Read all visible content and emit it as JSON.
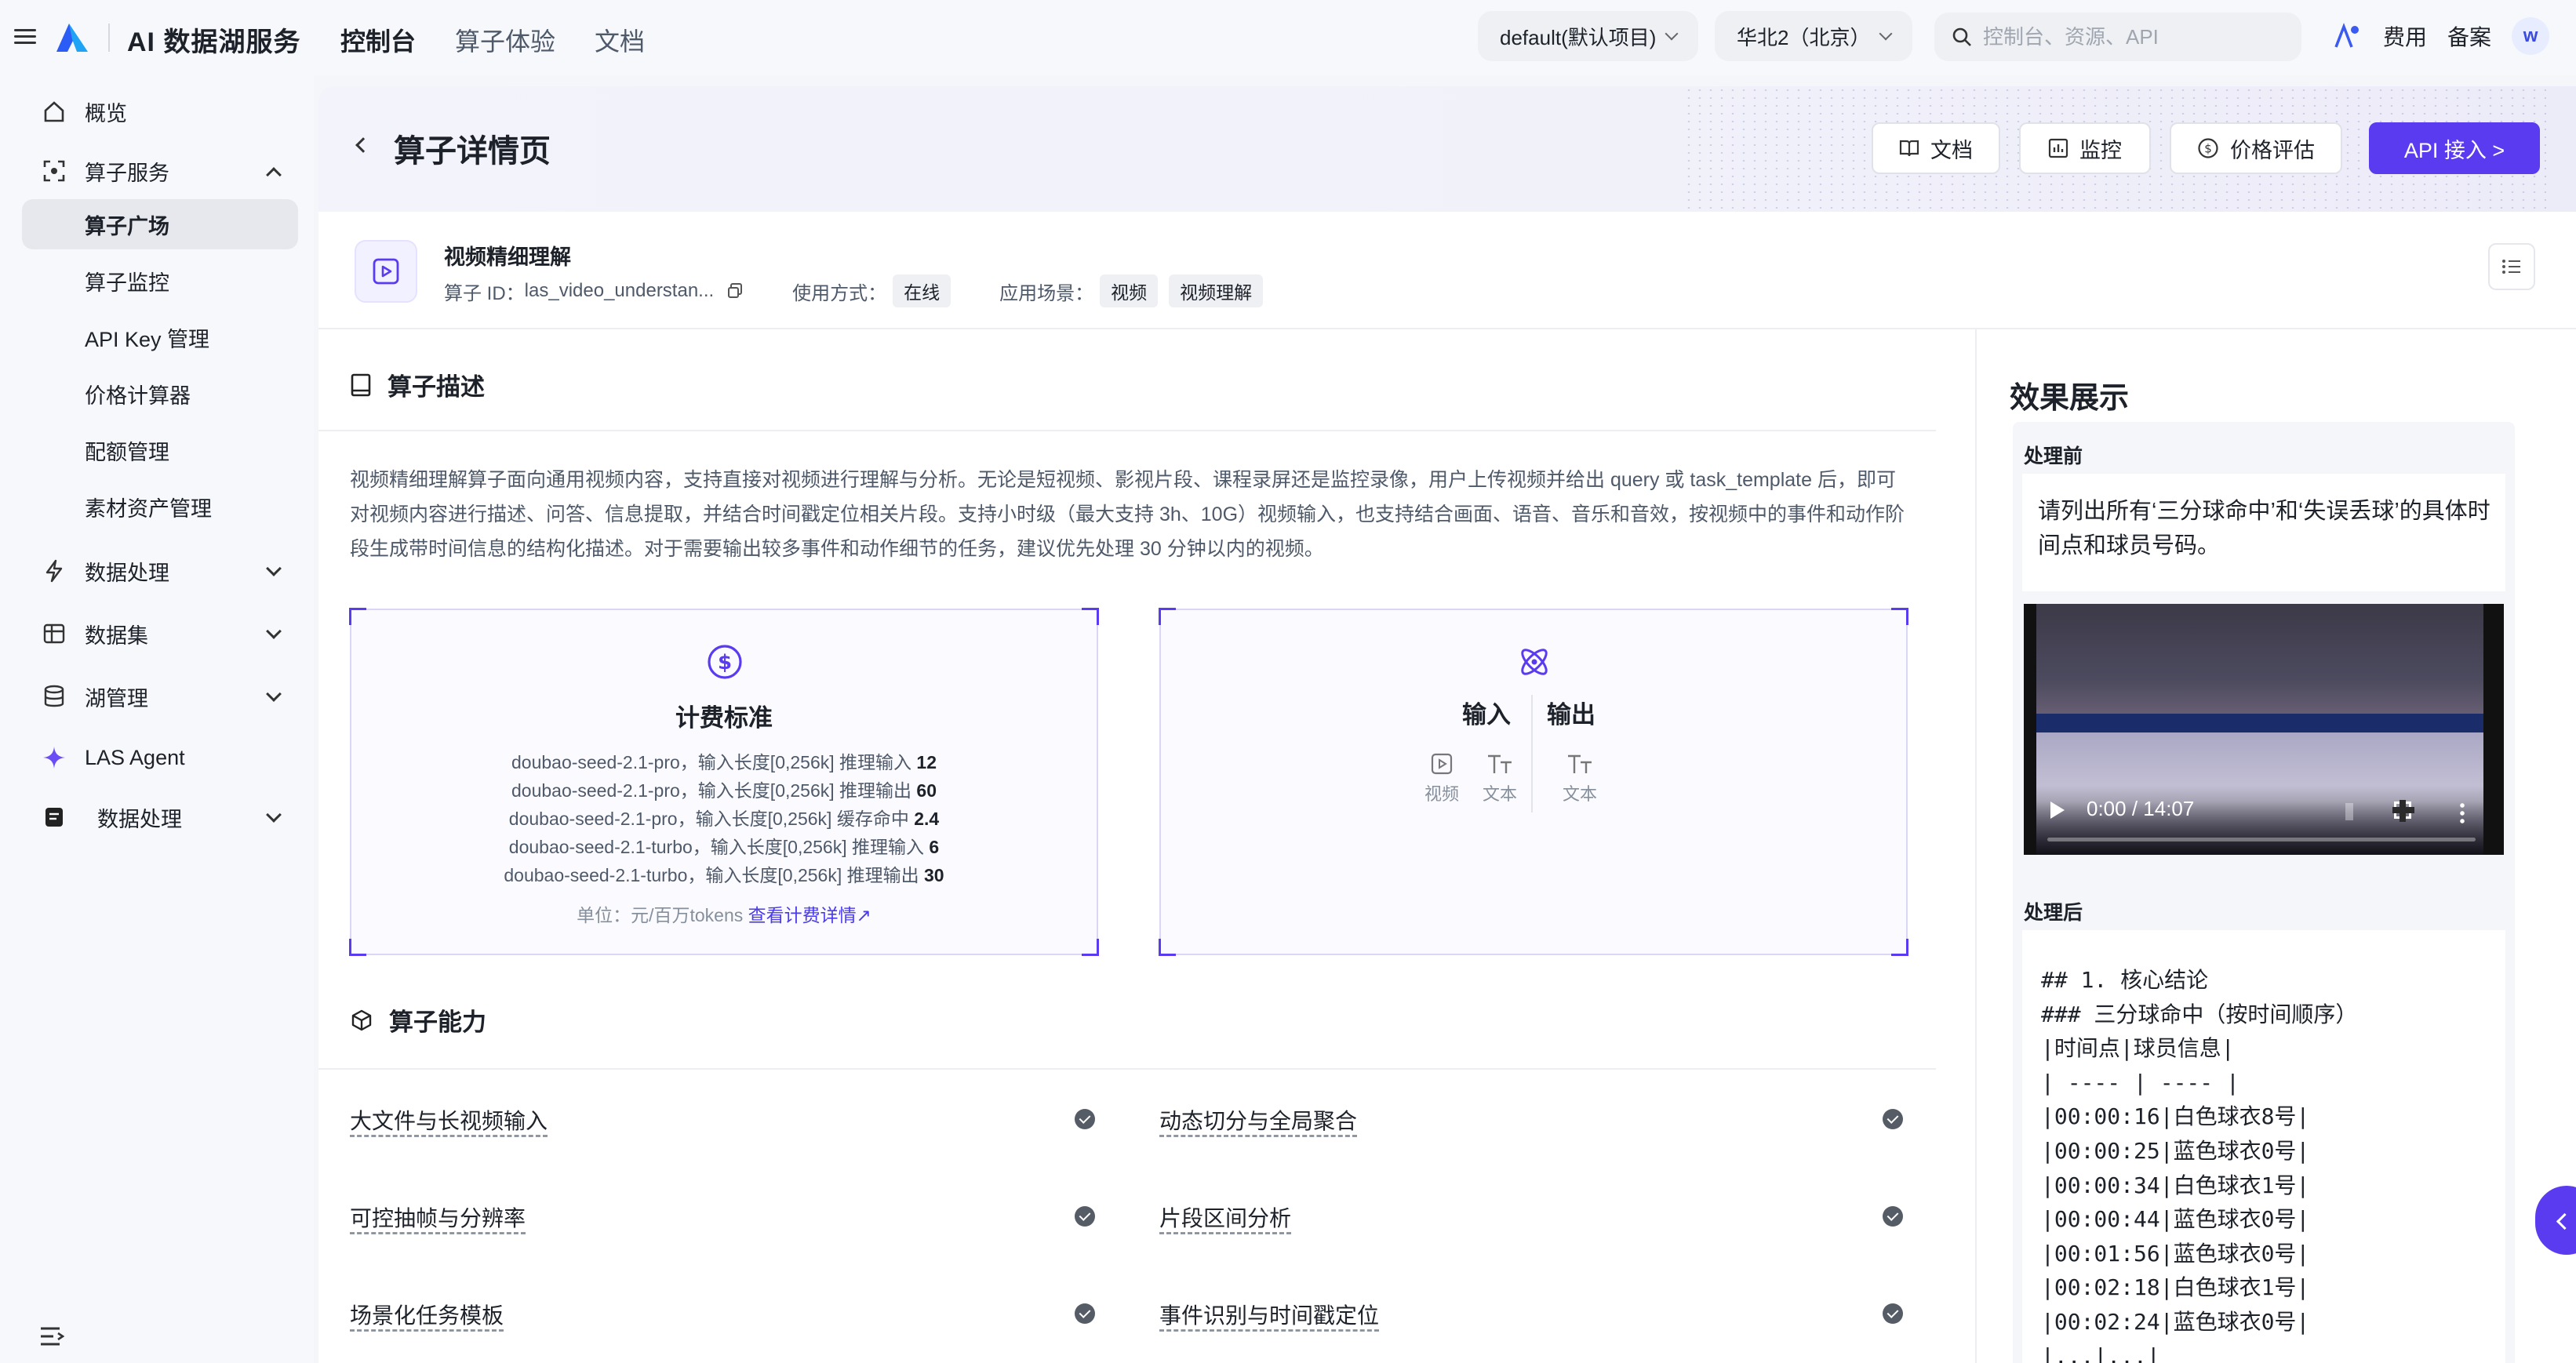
{
  "topbar": {
    "brand": "AI 数据湖服务",
    "nav": [
      "控制台",
      "算子体验",
      "文档"
    ],
    "project": "default(默认项目)",
    "region": "华北2（北京）",
    "search_placeholder": "控制台、资源、API",
    "fees": "费用",
    "filing": "备案",
    "avatar": "w"
  },
  "sidebar": {
    "overview": "概览",
    "operator_service": "算子服务",
    "subs": [
      "算子广场",
      "算子监控",
      "API Key 管理",
      "价格计算器",
      "配额管理",
      "素材资产管理"
    ],
    "data_processing": "数据处理",
    "datasets": "数据集",
    "lake_mgmt": "湖管理",
    "las_agent": "LAS Agent",
    "data_processing2": "数据处理"
  },
  "header": {
    "title": "算子详情页",
    "btn_docs": "文档",
    "btn_monitor": "监控",
    "btn_price": "价格评估",
    "btn_api": "API 接入 >"
  },
  "operator": {
    "name": "视频精细理解",
    "id_label": "算子 ID：",
    "id_value": "las_video_understan...",
    "usage_label": "使用方式：",
    "usage_value": "在线",
    "scene_label": "应用场景：",
    "scene_tags": [
      "视频",
      "视频理解"
    ]
  },
  "description": {
    "heading": "算子描述",
    "text": "视频精细理解算子面向通用视频内容，支持直接对视频进行理解与分析。无论是短视频、影视片段、课程录屏还是监控录像，用户上传视频并给出 query 或 task_template 后，即可对视频内容进行描述、问答、信息提取，并结合时间戳定位相关片段。支持小时级（最大支持 3h、10G）视频输入，也支持结合画面、语音、音乐和音效，按视频中的事件和动作阶段生成带时间信息的结构化描述。对于需要输出较多事件和动作细节的任务，建议优先处理 30 分钟以内的视频。"
  },
  "pricing": {
    "title": "计费标准",
    "lines": [
      {
        "text": "doubao-seed-2.1-pro，输入长度[0,256k] 推理输入 ",
        "price": "12"
      },
      {
        "text": "doubao-seed-2.1-pro，输入长度[0,256k] 推理输出 ",
        "price": "60"
      },
      {
        "text": "doubao-seed-2.1-pro，输入长度[0,256k] 缓存命中 ",
        "price": "2.4"
      },
      {
        "text": "doubao-seed-2.1-turbo，输入长度[0,256k] 推理输入 ",
        "price": "6"
      },
      {
        "text": "doubao-seed-2.1-turbo，输入长度[0,256k] 推理输出 ",
        "price": "30"
      }
    ],
    "unit": "单位：元/百万tokens ",
    "link": "查看计费详情↗"
  },
  "io": {
    "input_title": "输入",
    "output_title": "输出",
    "input_items": [
      "视频",
      "文本"
    ],
    "output_items": [
      "文本"
    ]
  },
  "capabilities": {
    "heading": "算子能力",
    "items": [
      "大文件与长视频输入",
      "动态切分与全局聚合",
      "可控抽帧与分辨率",
      "片段区间分析",
      "场景化任务模板",
      "事件识别与时间戳定位"
    ]
  },
  "effect": {
    "title": "效果展示",
    "before_label": "处理前",
    "prompt": "请列出所有‘三分球命中’和‘失误丢球’的具体时间点和球员号码。",
    "video_time": "0:00 / 14:07",
    "after_label": "处理后",
    "output": "## 1. 核心结论\n### 三分球命中（按时间顺序）\n|时间点|球员信息|\n| ---- | ---- |\n|00:00:16|白色球衣8号|\n|00:00:25|蓝色球衣0号|\n|00:00:34|白色球衣1号|\n|00:00:44|蓝色球衣0号|\n|00:01:56|蓝色球衣0号|\n|00:02:18|白色球衣1号|\n|00:02:24|蓝色球衣0号|\n|...|...|"
  }
}
